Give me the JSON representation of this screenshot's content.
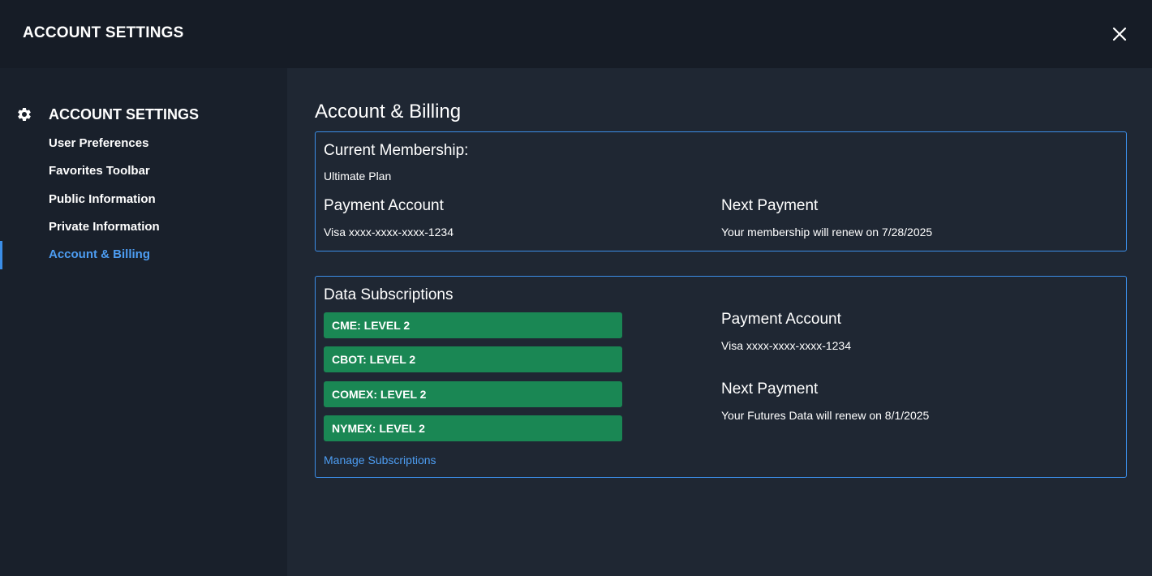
{
  "header": {
    "title": "ACCOUNT SETTINGS"
  },
  "sidebar": {
    "title": "ACCOUNT SETTINGS",
    "items": [
      {
        "label": "User Preferences"
      },
      {
        "label": "Favorites Toolbar"
      },
      {
        "label": "Public Information"
      },
      {
        "label": "Private Information"
      },
      {
        "label": "Account & Billing",
        "active": true
      }
    ]
  },
  "main": {
    "title": "Account & Billing",
    "membership": {
      "heading": "Current Membership:",
      "plan": "Ultimate Plan",
      "payment_heading": "Payment Account",
      "payment_value": "Visa xxxx-xxxx-xxxx-1234",
      "next_heading": "Next Payment",
      "next_value": "Your membership will renew on 7/28/2025"
    },
    "data_subscriptions": {
      "heading": "Data Subscriptions",
      "items": [
        {
          "label": "CME: LEVEL 2"
        },
        {
          "label": "CBOT: LEVEL 2"
        },
        {
          "label": "COMEX: LEVEL 2"
        },
        {
          "label": "NYMEX: LEVEL 2"
        }
      ],
      "manage_link": "Manage Subscriptions",
      "payment_heading": "Payment Account",
      "payment_value": "Visa xxxx-xxxx-xxxx-1234",
      "next_heading": "Next Payment",
      "next_value": "Your Futures Data will renew on 8/1/2025"
    }
  },
  "icons": {
    "close": "close-icon",
    "settings": "gear-icon"
  },
  "colors": {
    "accent": "#3b8ee8",
    "subscription_badge": "#1a8754"
  }
}
